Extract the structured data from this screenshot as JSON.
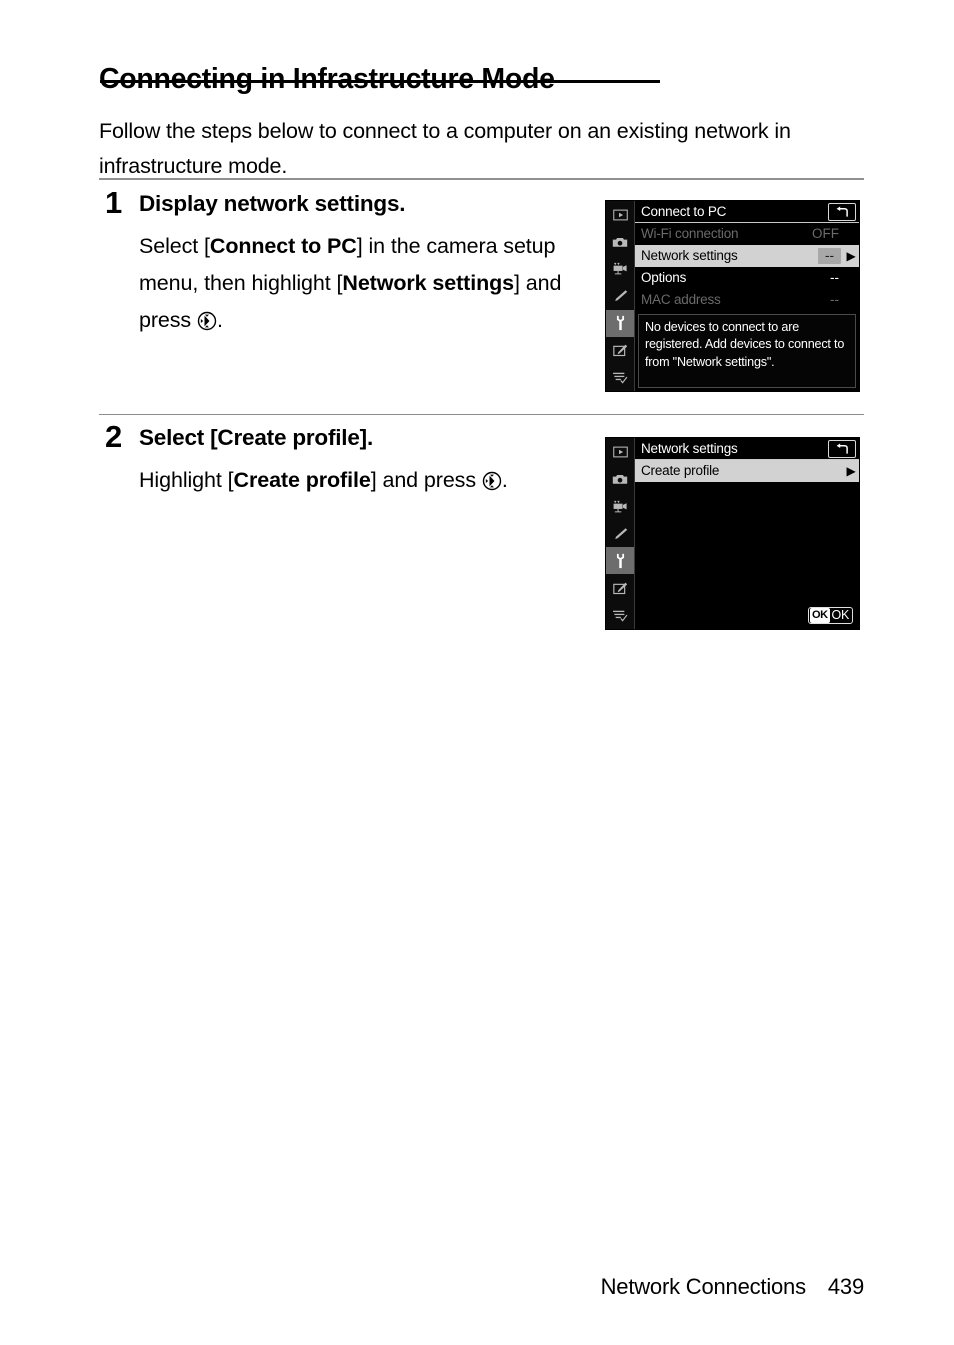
{
  "heading": "Connecting in Infrastructure Mode",
  "intro": "Follow the steps below to connect to a computer on an existing network in infrastructure mode.",
  "steps": [
    {
      "number": "1",
      "title": "Display network settings.",
      "body_parts": {
        "p1": "Select [",
        "b1": "Connect to PC",
        "p2": "] in the camera setup menu, then highlight [",
        "b2": "Network settings",
        "p3": "] and press ",
        "p4": "."
      }
    },
    {
      "number": "2",
      "title": "Select [Create profile].",
      "body_parts": {
        "p1": "Highlight [",
        "b1": "Create profile",
        "p2": "] and press ",
        "p3": "."
      }
    }
  ],
  "screens": [
    {
      "title": "Connect to PC",
      "help_badge_icon": "return-arrow-icon",
      "rail_icons": [
        "playback-icon",
        "photo-shooting-menu-icon",
        "movie-shooting-menu-icon",
        "custom-settings-pencil-icon",
        "setup-menu-wrench-icon",
        "retouch-menu-icon",
        "my-menu-icon"
      ],
      "rail_active_index": 4,
      "rows": [
        {
          "label": "Wi-Fi connection",
          "value": "OFF",
          "state": "dim",
          "caret": ""
        },
        {
          "label": "Network settings",
          "value": "--",
          "state": "selected",
          "caret": "▶"
        },
        {
          "label": "Options",
          "value": "--",
          "state": "normal",
          "caret": ""
        },
        {
          "label": "MAC address",
          "value": "--",
          "state": "dim",
          "caret": ""
        }
      ],
      "help_text": "No devices to connect to are registered. Add devices to connect to from \"Network settings\".",
      "footer_ok": null
    },
    {
      "title": "Network settings",
      "help_badge_icon": "return-arrow-icon",
      "rail_icons": [
        "playback-icon",
        "photo-shooting-menu-icon",
        "movie-shooting-menu-icon",
        "custom-settings-pencil-icon",
        "setup-menu-wrench-icon",
        "retouch-menu-icon",
        "my-menu-icon"
      ],
      "rail_active_index": 4,
      "rows": [
        {
          "label": "Create profile",
          "value": "",
          "state": "selected",
          "caret": "▶"
        }
      ],
      "help_text": null,
      "footer_ok": {
        "glyph": "OK",
        "label": "OK"
      }
    }
  ],
  "footer": {
    "chapter": "Network Connections",
    "page": "439"
  },
  "colors": {
    "text": "#000000",
    "rule_thick": "#909090",
    "rule_thin": "#8c8c8c",
    "lcd_background": "#000000",
    "lcd_selected_row": "#d2d2d2",
    "lcd_dim_text": "#6a6a6a",
    "lcd_rail_active": "#6d6d6d"
  }
}
